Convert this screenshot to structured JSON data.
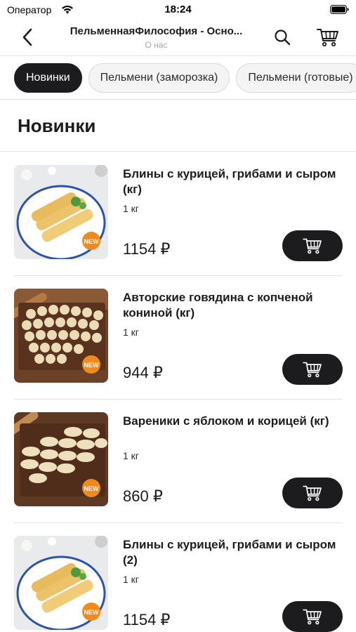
{
  "status_bar": {
    "carrier": "Оператор",
    "time": "18:24"
  },
  "nav": {
    "title": "ПельменнаяФилософия - Осно...",
    "subtitle": "О нас",
    "back_icon": "chevron-left-icon",
    "search_icon": "search-icon",
    "cart_icon": "cart-icon"
  },
  "categories": [
    {
      "label": "Новинки",
      "active": true
    },
    {
      "label": "Пельмени (заморозка)",
      "active": false
    },
    {
      "label": "Пельмени (готовые)",
      "active": false
    }
  ],
  "section": {
    "title": "Новинки"
  },
  "products": [
    {
      "name": "Блины с курицей, грибами и сыром (кг)",
      "weight": "1 кг",
      "price": "1154 ₽",
      "badge": "NEW",
      "image": "pancakes"
    },
    {
      "name": "Авторские говядина с копченой кониной (кг)",
      "weight": "1 кг",
      "price": "944 ₽",
      "badge": "NEW",
      "image": "dumplings"
    },
    {
      "name": "Вареники с яблоком и корицей (кг)",
      "weight": "1 кг",
      "price": "860 ₽",
      "badge": "NEW",
      "image": "vareniki"
    },
    {
      "name": "Блины с курицей, грибами и сыром (2)",
      "weight": "1 кг",
      "price": "1154 ₽",
      "badge": "NEW",
      "image": "pancakes"
    }
  ],
  "colors": {
    "accent": "#1c1c1e",
    "badge": "#f08a1c",
    "divider": "#e3e3e6"
  }
}
